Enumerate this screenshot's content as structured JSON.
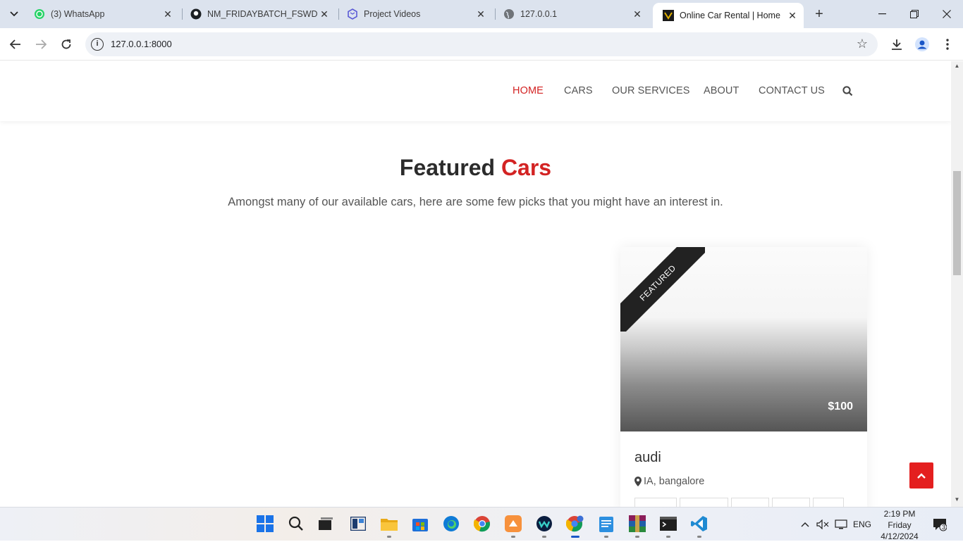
{
  "browser": {
    "tabs": [
      {
        "title": "(3) WhatsApp",
        "icon": "whatsapp-icon"
      },
      {
        "title": "NM_FRIDAYBATCH_FSWD_PR",
        "icon": "github-icon"
      },
      {
        "title": "Project Videos",
        "icon": "layers-icon"
      },
      {
        "title": "127.0.0.1",
        "icon": "globe-icon"
      },
      {
        "title": "Online Car Rental | Home",
        "icon": "site-logo-icon",
        "active": true
      }
    ],
    "url": "127.0.0.1:8000"
  },
  "nav": {
    "links": [
      "HOME",
      "CARS",
      "OUR SERVICES",
      "ABOUT",
      "CONTACT US"
    ],
    "active": "HOME",
    "accent_color": "#d32323"
  },
  "featured": {
    "title_part1": "Featured",
    "title_part2": "Cars",
    "subtitle": "Amongst many of our available cars, here are some few picks that you might have an interest in."
  },
  "car": {
    "ribbon": "FEATURED",
    "price": "$100",
    "name": "audi",
    "location": "IA, bangalore"
  },
  "taskbar": {
    "language": "ENG",
    "time": "2:19 PM",
    "day": "Friday",
    "date": "4/12/2024",
    "notification_count": "3"
  }
}
